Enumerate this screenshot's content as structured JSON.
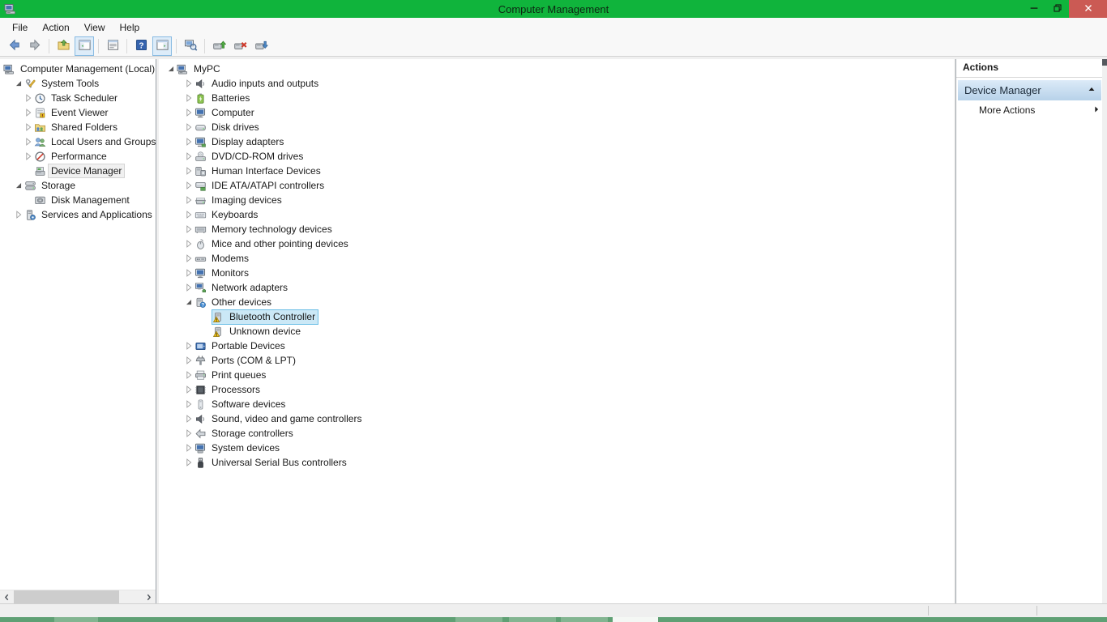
{
  "titlebar": {
    "title": "Computer Management",
    "controls": [
      {
        "name": "minimize",
        "icon": "minimize-icon"
      },
      {
        "name": "restore",
        "icon": "restore-icon"
      },
      {
        "name": "close",
        "icon": "close-icon"
      }
    ]
  },
  "menubar": {
    "items": [
      "File",
      "Action",
      "View",
      "Help"
    ]
  },
  "toolbar": {
    "buttons": [
      {
        "icon": "back-icon"
      },
      {
        "icon": "forward-icon"
      },
      {
        "separator": true
      },
      {
        "icon": "up-level-icon"
      },
      {
        "icon": "show-console-tree-icon",
        "active": true
      },
      {
        "separator": true
      },
      {
        "icon": "export-list-icon"
      },
      {
        "separator": true
      },
      {
        "icon": "help-icon"
      },
      {
        "icon": "show-action-pane-icon",
        "active": true
      },
      {
        "separator": true
      },
      {
        "icon": "search-computer-icon"
      },
      {
        "separator": true
      },
      {
        "icon": "update-driver-icon"
      },
      {
        "icon": "uninstall-device-icon"
      },
      {
        "icon": "scan-hardware-icon"
      }
    ]
  },
  "console_tree": {
    "items": [
      {
        "label": "Computer Management (Local)",
        "depth": 0,
        "icon": "computer",
        "expander": "none"
      },
      {
        "label": "System Tools",
        "depth": 1,
        "icon": "system-tools",
        "expander": "expanded"
      },
      {
        "label": "Task Scheduler",
        "depth": 2,
        "icon": "task-scheduler",
        "expander": "collapsed"
      },
      {
        "label": "Event Viewer",
        "depth": 2,
        "icon": "event-viewer",
        "expander": "collapsed"
      },
      {
        "label": "Shared Folders",
        "depth": 2,
        "icon": "shared-folders",
        "expander": "collapsed"
      },
      {
        "label": "Local Users and Groups",
        "depth": 2,
        "icon": "local-users-groups",
        "expander": "collapsed"
      },
      {
        "label": "Performance",
        "depth": 2,
        "icon": "performance",
        "expander": "collapsed"
      },
      {
        "label": "Device Manager",
        "depth": 2,
        "icon": "device-manager",
        "expander": "slot",
        "selected": "inactive"
      },
      {
        "label": "Storage",
        "depth": 1,
        "icon": "storage",
        "expander": "expanded"
      },
      {
        "label": "Disk Management",
        "depth": 2,
        "icon": "disk-management",
        "expander": "slot"
      },
      {
        "label": "Services and Applications",
        "depth": 1,
        "icon": "services-applications",
        "expander": "collapsed"
      }
    ]
  },
  "device_tree": {
    "items": [
      {
        "label": "MyPC",
        "depth": 0,
        "icon": "computer",
        "expander": "expanded"
      },
      {
        "label": "Audio inputs and outputs",
        "depth": 1,
        "icon": "speaker",
        "expander": "collapsed"
      },
      {
        "label": "Batteries",
        "depth": 1,
        "icon": "battery",
        "expander": "collapsed"
      },
      {
        "label": "Computer",
        "depth": 1,
        "icon": "monitor",
        "expander": "collapsed"
      },
      {
        "label": "Disk drives",
        "depth": 1,
        "icon": "disk-drive",
        "expander": "collapsed"
      },
      {
        "label": "Display adapters",
        "depth": 1,
        "icon": "display-adapter",
        "expander": "collapsed"
      },
      {
        "label": "DVD/CD-ROM drives",
        "depth": 1,
        "icon": "dvd-drive",
        "expander": "collapsed"
      },
      {
        "label": "Human Interface Devices",
        "depth": 1,
        "icon": "hid-device",
        "expander": "collapsed"
      },
      {
        "label": "IDE ATA/ATAPI controllers",
        "depth": 1,
        "icon": "ide-controller",
        "expander": "collapsed"
      },
      {
        "label": "Imaging devices",
        "depth": 1,
        "icon": "imaging-device",
        "expander": "collapsed"
      },
      {
        "label": "Keyboards",
        "depth": 1,
        "icon": "keyboard",
        "expander": "collapsed"
      },
      {
        "label": "Memory technology devices",
        "depth": 1,
        "icon": "memory-card",
        "expander": "collapsed"
      },
      {
        "label": "Mice and other pointing devices",
        "depth": 1,
        "icon": "mouse",
        "expander": "collapsed"
      },
      {
        "label": "Modems",
        "depth": 1,
        "icon": "modem",
        "expander": "collapsed"
      },
      {
        "label": "Monitors",
        "depth": 1,
        "icon": "monitor",
        "expander": "collapsed"
      },
      {
        "label": "Network adapters",
        "depth": 1,
        "icon": "network-adapter",
        "expander": "collapsed"
      },
      {
        "label": "Other devices",
        "depth": 1,
        "icon": "unknown-category",
        "expander": "expanded"
      },
      {
        "label": "Bluetooth Controller",
        "depth": 2,
        "icon": "unknown-device-warning",
        "expander": "slot",
        "selected": "active"
      },
      {
        "label": "Unknown device",
        "depth": 2,
        "icon": "unknown-device-warning",
        "expander": "slot"
      },
      {
        "label": "Portable Devices",
        "depth": 1,
        "icon": "portable-device",
        "expander": "collapsed"
      },
      {
        "label": "Ports (COM & LPT)",
        "depth": 1,
        "icon": "serial-port",
        "expander": "collapsed"
      },
      {
        "label": "Print queues",
        "depth": 1,
        "icon": "printer",
        "expander": "collapsed"
      },
      {
        "label": "Processors",
        "depth": 1,
        "icon": "processor",
        "expander": "collapsed"
      },
      {
        "label": "Software devices",
        "depth": 1,
        "icon": "software-device",
        "expander": "collapsed"
      },
      {
        "label": "Sound, video and game controllers",
        "depth": 1,
        "icon": "speaker",
        "expander": "collapsed"
      },
      {
        "label": "Storage controllers",
        "depth": 1,
        "icon": "storage-controller",
        "expander": "collapsed"
      },
      {
        "label": "System devices",
        "depth": 1,
        "icon": "system-device",
        "expander": "collapsed"
      },
      {
        "label": "Universal Serial Bus controllers",
        "depth": 1,
        "icon": "usb-controller",
        "expander": "collapsed"
      }
    ]
  },
  "actions": {
    "header": "Actions",
    "device_manager_label": "Device Manager",
    "more_actions_label": "More Actions",
    "collapse_icon": "chevron-up-icon",
    "submenu_icon": "chevron-right-icon"
  },
  "colors": {
    "titlebar_green": "#10b43c",
    "close_red": "#cb5a54",
    "selection_active_bg": "#cbe8f6",
    "selection_active_border": "#70c0e7",
    "selection_inactive_bg": "#f0f0f0",
    "actions_header_top": "#dcebf8",
    "actions_header_bottom": "#b7d2e9",
    "taskbar_green": "#5fa074"
  }
}
